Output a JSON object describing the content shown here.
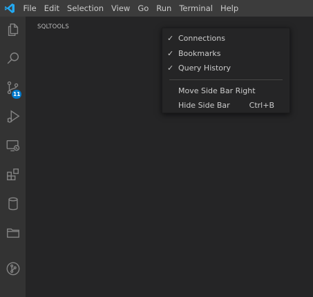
{
  "menubar": {
    "items": [
      "File",
      "Edit",
      "Selection",
      "View",
      "Go",
      "Run",
      "Terminal",
      "Help"
    ],
    "logo_icon": "vscode-logo-icon",
    "accent": "#23a9f2"
  },
  "activitybar": {
    "items": [
      {
        "icon": "explorer-icon"
      },
      {
        "icon": "search-icon"
      },
      {
        "icon": "source-control-icon",
        "badge": "11"
      },
      {
        "icon": "run-debug-icon"
      },
      {
        "icon": "remote-explorer-icon"
      },
      {
        "icon": "extensions-icon"
      },
      {
        "icon": "database-icon"
      },
      {
        "icon": "folder-icon"
      },
      {
        "icon": "git-graph-icon"
      }
    ],
    "badge_color": "#007acc"
  },
  "sidebar": {
    "title": "SQLTOOLS"
  },
  "context_menu": {
    "toggles": [
      {
        "label": "Connections",
        "checked": true,
        "check": "✓"
      },
      {
        "label": "Bookmarks",
        "checked": true,
        "check": "✓"
      },
      {
        "label": "Query History",
        "checked": true,
        "check": "✓"
      }
    ],
    "actions": [
      {
        "label": "Move Side Bar Right",
        "shortcut": ""
      },
      {
        "label": "Hide Side Bar",
        "shortcut": "Ctrl+B"
      }
    ]
  }
}
